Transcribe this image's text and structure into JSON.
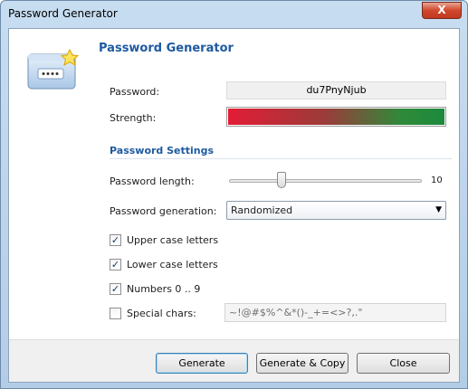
{
  "window": {
    "title": "Password Generator",
    "close_glyph": "X"
  },
  "header": {
    "heading": "Password Generator",
    "icon": "password-field-star-icon"
  },
  "password": {
    "label": "Password:",
    "value": "du7PnyNjub"
  },
  "strength": {
    "label": "Strength:",
    "level": 0.95,
    "colors": [
      "#e21c35",
      "#1c8a3c"
    ]
  },
  "settings": {
    "section_title": "Password Settings",
    "length": {
      "label": "Password length:",
      "value": "10",
      "slider_fraction": 0.28
    },
    "generation": {
      "label": "Password generation:",
      "selected": "Randomized"
    },
    "options": [
      {
        "label": "Upper case letters",
        "checked": true
      },
      {
        "label": "Lower case letters",
        "checked": true
      },
      {
        "label": "Numbers 0 .. 9",
        "checked": true
      },
      {
        "label": "Special chars:",
        "checked": false
      }
    ],
    "special_chars": "~!@#$%^&*()-_+=<>?,.\""
  },
  "buttons": {
    "generate": "Generate",
    "generate_copy": "Generate & Copy",
    "close": "Close"
  },
  "colors": {
    "accent": "#1e5aa0"
  }
}
